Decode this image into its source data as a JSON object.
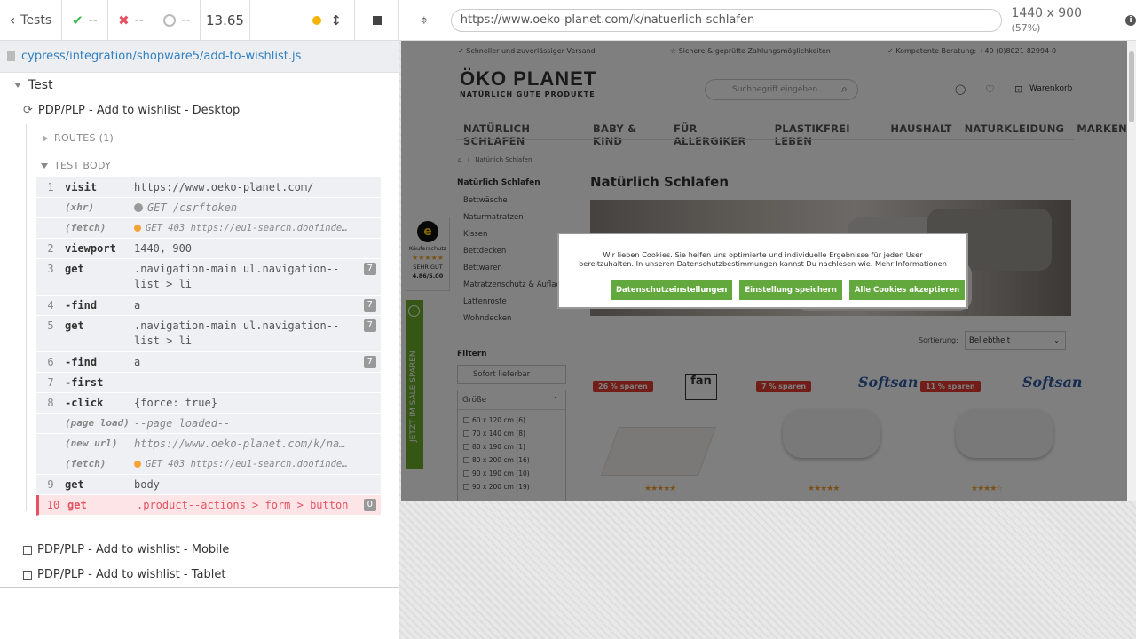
{
  "reporter": {
    "tests_label": "Tests",
    "passed": "--",
    "failed": "--",
    "pending": "--",
    "duration": "13.65"
  },
  "spec_path": "cypress/integration/shopware5/add-to-wishlist.js",
  "suite": {
    "title": "Test",
    "running_test": "PDP/PLP - Add to wishlist - Desktop",
    "routes_label": "ROUTES (1)",
    "body_label": "TEST BODY"
  },
  "commands": [
    {
      "num": "1",
      "name": "visit",
      "msg": "https://www.oeko-planet.com/"
    },
    {
      "num": "",
      "name": "(xhr)",
      "msg": "GET /csrftoken",
      "dot": "gray"
    },
    {
      "num": "",
      "name": "(fetch)",
      "msg": "GET 403 https://eu1-search.doofinder.com/5/search?hashid=6ae0e7...",
      "dot": "orange"
    },
    {
      "num": "2",
      "name": "viewport",
      "msg": "1440, 900"
    },
    {
      "num": "3",
      "name": "get",
      "msg": ".navigation-main ul.navigation--list > li",
      "count": "7"
    },
    {
      "num": "4",
      "name": "-find",
      "msg": "a",
      "count": "7"
    },
    {
      "num": "5",
      "name": "get",
      "msg": ".navigation-main ul.navigation--list > li",
      "count": "7"
    },
    {
      "num": "6",
      "name": "-find",
      "msg": "a",
      "count": "7"
    },
    {
      "num": "7",
      "name": "-first",
      "msg": ""
    },
    {
      "num": "8",
      "name": "-click",
      "msg": "{force: true}"
    },
    {
      "num": "",
      "name": "(page load)",
      "msg": "--page loaded--"
    },
    {
      "num": "",
      "name": "(new url)",
      "msg": "https://www.oeko-planet.com/k/natuerlich-schlafen"
    },
    {
      "num": "",
      "name": "(fetch)",
      "msg": "GET 403 https://eu1-search.doofinder.com/5/search?hashid=6ae0e7...",
      "dot": "orange"
    },
    {
      "num": "9",
      "name": "get",
      "msg": "body"
    },
    {
      "num": "10",
      "name": "get",
      "msg": ".product--actions > form > button",
      "count": "0"
    }
  ],
  "pending_tests": [
    "PDP/PLP - Add to wishlist - Mobile",
    "PDP/PLP - Add to wishlist - Tablet"
  ],
  "aut": {
    "url": "https://www.oeko-planet.com/k/natuerlich-schlafen",
    "viewport": "1440 x 900",
    "scale": "(57%)"
  },
  "site": {
    "usp": [
      "Schneller und zuverlässiger Versand",
      "Sichere & geprüfte Zahlungsmöglichkeiten",
      "Kompetente Beratung: +49 (0)8021-82994-0"
    ],
    "logo_top": "ÖKO PLANET",
    "logo_bottom": "NATÜRLICH GUTE PRODUKTE",
    "search_placeholder": "Suchbegriff eingeben...",
    "cart": "Warenkorb",
    "nav": [
      "NATÜRLICH SCHLAFEN",
      "BABY & KIND",
      "FÜR ALLERGIKER",
      "PLASTIKFREI LEBEN",
      "HAUSHALT",
      "NATURKLEIDUNG",
      "MARKEN"
    ],
    "breadcrumb": "Natürlich Schlafen",
    "cat_title": "Natürlich Schlafen",
    "categories": [
      "Bettwäsche",
      "Naturmatratzen",
      "Kissen",
      "Bettdecken",
      "Bettwaren",
      "Matratzenschutz & Auflagen",
      "Lattenroste",
      "Wohndecken"
    ],
    "h1": "Natürlich Schlafen",
    "sort_label": "Sortierung:",
    "sort_value": "Beliebtheit",
    "filter_title": "Filtern",
    "filter_instock": "Sofort lieferbar",
    "size_title": "Größe",
    "sizes": [
      "60 x 120 cm (6)",
      "70 x 140 cm (8)",
      "80 x 190 cm (1)",
      "80 x 200 cm (16)",
      "90 x 190 cm (10)",
      "90 x 200 cm (19)"
    ],
    "badges": [
      "26 % sparen",
      "7 % sparen",
      "11 % sparen"
    ],
    "brands": [
      "Softsan",
      "Softsan"
    ],
    "trust": {
      "label": "Käuferschutz",
      "rating": "SEHR GUT",
      "score": "4.86/5.00"
    },
    "sale_tab": "JETZT IM SALE SPAREN",
    "cookie": {
      "text": "Wir lieben Cookies. Sie helfen uns optimierte und individuelle Ergebnisse für jeden User bereitzuhalten. In unseren Datenschutzbestimmungen kannst Du nachlesen wie. Mehr Informationen",
      "btn1": "Datenschutzeinstellungen",
      "btn2": "Einstellung speichern",
      "btn3": "Alle Cookies akzeptieren"
    }
  }
}
